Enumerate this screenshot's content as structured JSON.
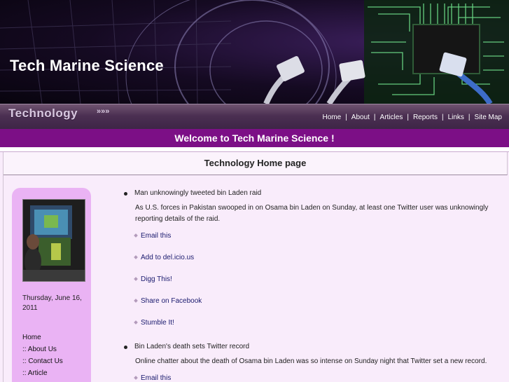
{
  "site": {
    "title": "Tech Marine Science",
    "section_label": "Technology",
    "section_arrows": "»»»"
  },
  "nav": {
    "items": [
      "Home",
      "About",
      "Articles",
      "Reports",
      "Links",
      "Site Map"
    ]
  },
  "welcome": "Welcome to Tech Marine Science !",
  "heading": "Technology Home page",
  "sidebar": {
    "date": "Thursday, June 16, 2011",
    "links": [
      "Home",
      ":: About Us",
      ":: Contact Us",
      ":: Article"
    ]
  },
  "articles": [
    {
      "title": "Man unknowingly tweeted bin Laden raid",
      "summary": "As U.S. forces in Pakistan swooped in on Osama bin Laden on Sunday, at least one Twitter user was unknowingly reporting details of the raid.",
      "actions": [
        "Email this",
        "Add to del.icio.us",
        "Digg This!",
        "Share on Facebook",
        "Stumble It!"
      ]
    },
    {
      "title": "Bin Laden's death sets Twitter record",
      "summary": "Online chatter about the death of Osama bin Laden was so intense on Sunday night that Twitter set a new record.",
      "actions": [
        "Email this"
      ]
    }
  ],
  "colors": {
    "welcome_bar": "#7c0f86",
    "sidebar_bg": "#eab3f4",
    "page_bg": "#f9ecfb",
    "link": "#1a1a6e"
  }
}
